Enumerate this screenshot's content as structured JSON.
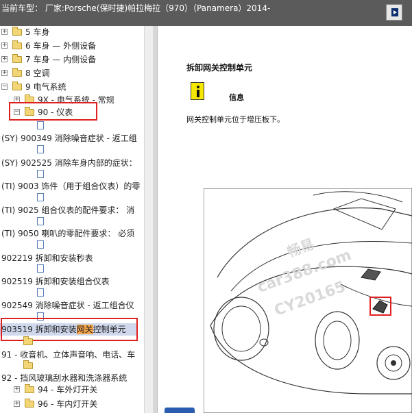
{
  "titlebar": {
    "text": "当前车型：  厂家:Porsche(保时捷)帕拉梅拉（970）（Panamera）2014-"
  },
  "tree": {
    "items": [
      {
        "label": "5 车身",
        "expander": "+"
      },
      {
        "label": "6 车身 — 外侧设备",
        "expander": "+"
      },
      {
        "label": "7 车身 — 内侧设备",
        "expander": "+"
      },
      {
        "label": "8 空调",
        "expander": "+"
      },
      {
        "label": "9 电气系统",
        "expander": "−"
      },
      {
        "label": "9X - 电气系统 - 常规",
        "expander": "+"
      },
      {
        "label": "90 - 仪表",
        "expander": "−"
      },
      {
        "label": "(SY) 900349 消除噪音症状 - 返工组"
      },
      {
        "label": "(SY) 902525 消除车身内部的症状："
      },
      {
        "label": "(TI) 9003 饰件（用于组合仪表）的零"
      },
      {
        "label": "(TI) 9025 组合仪表的配件要求： 消"
      },
      {
        "label": "(TI) 9050 喇叭的零配件要求： 必须"
      },
      {
        "label": "902219 拆卸和安装秒表"
      },
      {
        "label": "902519 拆卸和安装组合仪表"
      },
      {
        "label": "902549 消除噪音症状 - 返工组合仪"
      },
      {
        "label_before": "903519 拆卸和安装",
        "label_highlight": "网关",
        "label_after": "控制单元"
      },
      {
        "label": "91 - 收音机、立体声音响、电话、车"
      },
      {
        "label": "92 - 挡风玻璃刮水器和洗涤器系统"
      },
      {
        "label": "94 - 车外灯开关",
        "expander": "+"
      },
      {
        "label": "96 - 车内灯开关",
        "expander": "+"
      }
    ]
  },
  "document": {
    "title": "拆卸网关控制单元",
    "info_label": "信息",
    "body": "网关控制单元位于增压板下。",
    "watermark_1": "畅易",
    "watermark_2": "car388.com",
    "watermark_3": "CY20165"
  },
  "colors": {
    "titlebar_bg": "#5b5b5b",
    "highlight": "#f7a64a",
    "callout_red": "#e02020",
    "info_yellow": "#f6e700"
  }
}
